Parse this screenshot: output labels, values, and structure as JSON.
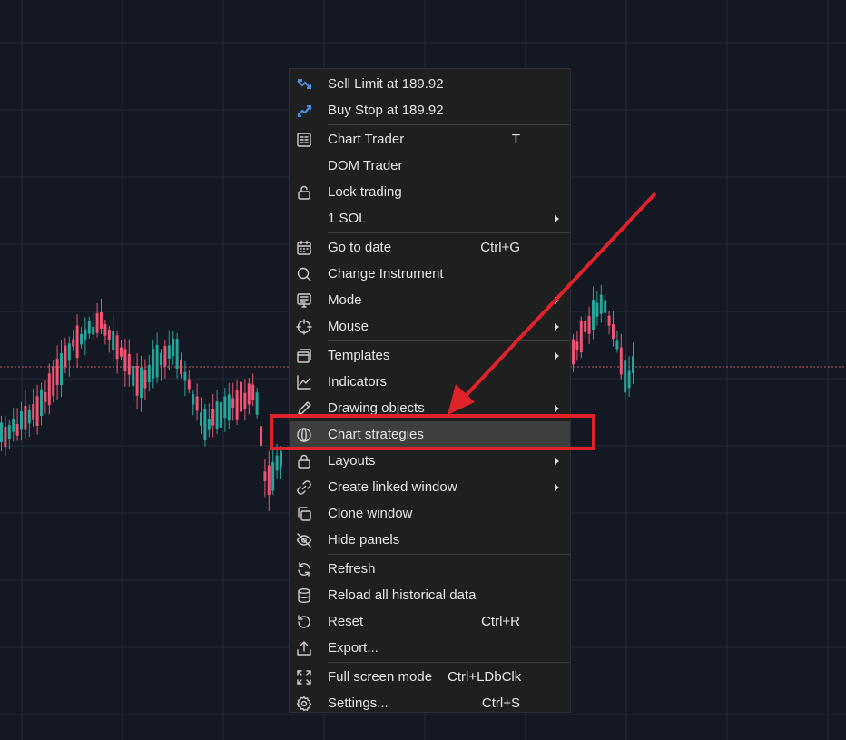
{
  "chart": {
    "background": "#141822",
    "grid_color": "#232a3a",
    "up_color": "#26a69a",
    "down_color": "#ef5474",
    "price_line_color": "#c45a6a"
  },
  "context_menu": {
    "groups": [
      [
        {
          "id": "sell-limit",
          "label": "Sell Limit at 189.92",
          "icon": "sell-limit-icon"
        },
        {
          "id": "buy-stop",
          "label": "Buy Stop at 189.92",
          "icon": "buy-stop-icon"
        }
      ],
      [
        {
          "id": "chart-trader",
          "label": "Chart Trader",
          "shortcut": "T",
          "icon": "chart-trader-icon"
        },
        {
          "id": "dom-trader",
          "label": "DOM Trader"
        },
        {
          "id": "lock-trading",
          "label": "Lock trading",
          "icon": "unlock-icon"
        },
        {
          "id": "quantity",
          "label": "1 SOL",
          "submenu": true
        }
      ],
      [
        {
          "id": "go-to-date",
          "label": "Go to date",
          "shortcut": "Ctrl+G",
          "icon": "calendar-icon"
        },
        {
          "id": "change-instrument",
          "label": "Change Instrument",
          "icon": "search-icon"
        },
        {
          "id": "mode",
          "label": "Mode",
          "submenu": true,
          "icon": "mode-icon"
        },
        {
          "id": "mouse",
          "label": "Mouse",
          "submenu": true,
          "icon": "crosshair-icon"
        }
      ],
      [
        {
          "id": "templates",
          "label": "Templates",
          "submenu": true,
          "icon": "templates-icon"
        },
        {
          "id": "indicators",
          "label": "Indicators",
          "icon": "indicators-icon"
        },
        {
          "id": "drawing-objects",
          "label": "Drawing objects",
          "submenu": true,
          "icon": "pencil-icon"
        },
        {
          "id": "chart-strategies",
          "label": "Chart strategies",
          "icon": "strategy-icon",
          "active": true
        },
        {
          "id": "layouts",
          "label": "Layouts",
          "submenu": true,
          "icon": "lock-icon"
        },
        {
          "id": "create-linked-window",
          "label": "Create linked window",
          "submenu": true,
          "icon": "link-icon"
        },
        {
          "id": "clone-window",
          "label": "Clone window",
          "icon": "clone-icon"
        },
        {
          "id": "hide-panels",
          "label": "Hide panels",
          "icon": "eye-off-icon"
        }
      ],
      [
        {
          "id": "refresh",
          "label": "Refresh",
          "icon": "refresh-icon"
        },
        {
          "id": "reload-history",
          "label": "Reload all historical data",
          "icon": "database-icon"
        },
        {
          "id": "reset",
          "label": "Reset",
          "shortcut": "Ctrl+R",
          "icon": "reset-icon"
        },
        {
          "id": "export",
          "label": "Export...",
          "icon": "export-icon"
        }
      ],
      [
        {
          "id": "full-screen",
          "label": "Full screen mode",
          "shortcut": "Ctrl+LDbClk",
          "icon": "fullscreen-icon"
        },
        {
          "id": "settings",
          "label": "Settings...",
          "shortcut": "Ctrl+S",
          "icon": "gear-icon"
        }
      ]
    ]
  },
  "annotation": {
    "color": "#e0232a",
    "highlight_target": "chart-strategies"
  }
}
